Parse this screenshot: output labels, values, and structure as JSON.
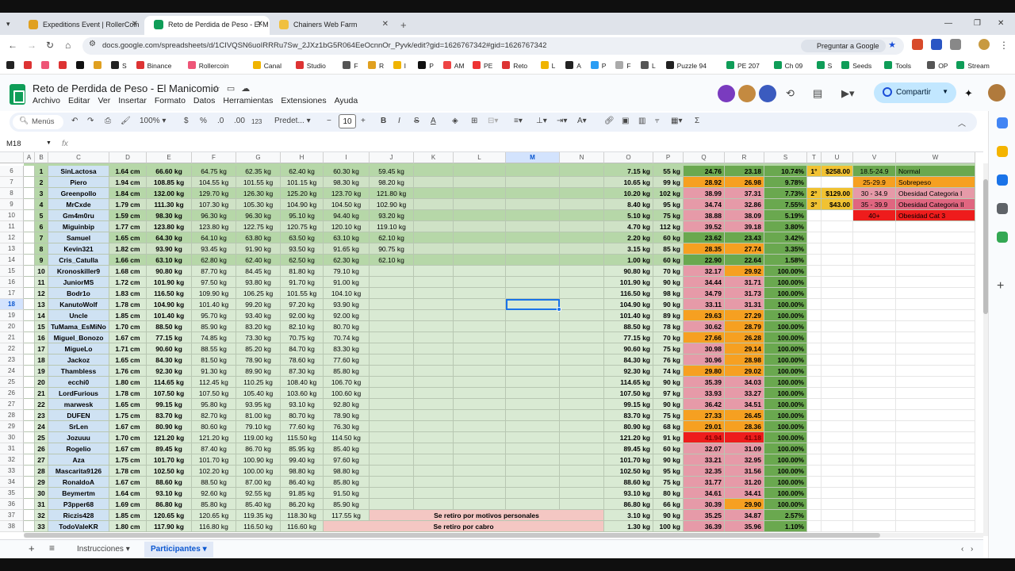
{
  "browser": {
    "tabs": [
      {
        "title": "Expeditions Event | RollerCoin",
        "active": false,
        "icon_color": "#e0a020"
      },
      {
        "title": "Reto de Perdida de Peso - El M",
        "active": true,
        "icon_color": "#0f9d58"
      },
      {
        "title": "Chainers Web Farm",
        "active": false,
        "icon_color": "#f0c040"
      }
    ],
    "url": "docs.google.com/spreadsheets/d/1CIVQSN6uoIRRRu7Sw_2JXz1bG5R064EeOcnnOr_Pyvk/edit?gid=1626767342#gid=1626767342",
    "google_btn": "Preguntar a Google",
    "bookmarks": [
      "S",
      "Binance",
      "Rollercoin",
      "Canal",
      "Studio",
      "F",
      "R",
      "I",
      "P",
      "AM",
      "PE",
      "Reto",
      "L",
      "A",
      "P",
      "F",
      "L",
      "Puzzle 94",
      "PE 207",
      "Ch 09",
      "S",
      "Seeds",
      "Tools",
      "OP",
      "Stream"
    ]
  },
  "sheets": {
    "title": "Reto de Perdida de Peso - El Manicomio",
    "menus": [
      "Archivo",
      "Editar",
      "Ver",
      "Insertar",
      "Formato",
      "Datos",
      "Herramientas",
      "Extensiones",
      "Ayuda"
    ],
    "share_label": "Compartir",
    "search_label": "Menús",
    "zoom": "100%",
    "currency": "$",
    "percent": "%",
    "dec_dec": ".0",
    "dec_inc": ".00",
    "num_fmt": "123",
    "font": "Predet...",
    "font_size": "10",
    "name_box": "M18",
    "fx": "fx",
    "sheet_tabs": [
      "Instrucciones",
      "Participantes"
    ],
    "active_sheet": "Participantes"
  },
  "grid": {
    "columns": [
      "A",
      "B",
      "C",
      "D",
      "E",
      "F",
      "G",
      "H",
      "I",
      "J",
      "K",
      "L",
      "M",
      "N",
      "O",
      "P",
      "Q",
      "R",
      "S",
      "T",
      "U",
      "V",
      "W"
    ],
    "selected_col": "M",
    "selected_row": 18,
    "rows": [
      {
        "n": 6,
        "num": "1",
        "name": "SinLactosa",
        "h": "1.64 cm",
        "w": [
          "66.60 kg",
          "64.75 kg",
          "62.35 kg",
          "62.40 kg",
          "60.30 kg",
          "59.45 kg"
        ],
        "lost": "7.15 kg",
        "goal": "55 kg",
        "q": "24.76",
        "r": "23.18",
        "s": "10.74%",
        "qc": "g",
        "rc": "g"
      },
      {
        "n": 7,
        "num": "2",
        "name": "Piero",
        "h": "1.94 cm",
        "w": [
          "108.85 kg",
          "104.55 kg",
          "101.55 kg",
          "101.15 kg",
          "98.30 kg",
          "98.20 kg"
        ],
        "lost": "10.65 kg",
        "goal": "99 kg",
        "q": "28.92",
        "r": "26.98",
        "s": "9.78%",
        "qc": "o",
        "rc": "o"
      },
      {
        "n": 8,
        "num": "3",
        "name": "Greenpollo",
        "h": "1.84 cm",
        "w": [
          "132.00 kg",
          "129.70 kg",
          "126.30 kg",
          "125.20 kg",
          "123.70 kg",
          "121.80 kg"
        ],
        "lost": "10.20 kg",
        "goal": "102 kg",
        "q": "38.99",
        "r": "37.31",
        "s": "7.73%",
        "qc": "p",
        "rc": "p"
      },
      {
        "n": 9,
        "num": "4",
        "name": "MrCxde",
        "h": "1.79 cm",
        "w": [
          "111.30 kg",
          "107.30 kg",
          "105.30 kg",
          "104.90 kg",
          "104.50 kg",
          "102.90 kg"
        ],
        "lost": "8.40 kg",
        "goal": "95 kg",
        "q": "34.74",
        "r": "32.86",
        "s": "7.55%",
        "qc": "p",
        "rc": "p"
      },
      {
        "n": 10,
        "num": "5",
        "name": "Gm4m0ru",
        "h": "1.59 cm",
        "w": [
          "98.30 kg",
          "96.30 kg",
          "96.30 kg",
          "95.10 kg",
          "94.40 kg",
          "93.20 kg"
        ],
        "lost": "5.10 kg",
        "goal": "75 kg",
        "q": "38.88",
        "r": "38.09",
        "s": "5.19%",
        "qc": "p",
        "rc": "p"
      },
      {
        "n": 11,
        "num": "6",
        "name": "Miguinbip",
        "h": "1.77 cm",
        "w": [
          "123.80 kg",
          "123.80 kg",
          "122.75 kg",
          "120.75 kg",
          "120.10 kg",
          "119.10 kg"
        ],
        "lost": "4.70 kg",
        "goal": "112 kg",
        "q": "39.52",
        "r": "39.18",
        "s": "3.80%",
        "qc": "p",
        "rc": "p"
      },
      {
        "n": 12,
        "num": "7",
        "name": "Samuel",
        "h": "1.65 cm",
        "w": [
          "64.30 kg",
          "64.10 kg",
          "63.80 kg",
          "63.50 kg",
          "63.10 kg",
          "62.10 kg"
        ],
        "lost": "2.20 kg",
        "goal": "60 kg",
        "q": "23.62",
        "r": "23.43",
        "s": "3.42%",
        "qc": "g",
        "rc": "g"
      },
      {
        "n": 13,
        "num": "8",
        "name": "Kevin321",
        "h": "1.82 cm",
        "w": [
          "93.90 kg",
          "93.45 kg",
          "91.90 kg",
          "93.50 kg",
          "91.65 kg",
          "90.75 kg"
        ],
        "lost": "3.15 kg",
        "goal": "85 kg",
        "q": "28.35",
        "r": "27.74",
        "s": "3.35%",
        "qc": "o",
        "rc": "o"
      },
      {
        "n": 14,
        "num": "9",
        "name": "Cris_Catulla",
        "h": "1.66 cm",
        "w": [
          "63.10 kg",
          "62.80 kg",
          "62.40 kg",
          "62.50 kg",
          "62.30 kg",
          "62.10 kg"
        ],
        "lost": "1.00 kg",
        "goal": "60 kg",
        "q": "22.90",
        "r": "22.64",
        "s": "1.58%",
        "qc": "g",
        "rc": "g"
      },
      {
        "n": 15,
        "num": "10",
        "name": "Kronoskiller9",
        "h": "1.68 cm",
        "w": [
          "90.80 kg",
          "87.70 kg",
          "84.45 kg",
          "81.80 kg",
          "79.10 kg",
          ""
        ],
        "lost": "90.80 kg",
        "goal": "70 kg",
        "q": "32.17",
        "r": "29.92",
        "s": "100.00%",
        "qc": "p",
        "rc": "o"
      },
      {
        "n": 16,
        "num": "11",
        "name": "JuniorMS",
        "h": "1.72 cm",
        "w": [
          "101.90 kg",
          "97.50 kg",
          "93.80 kg",
          "91.70 kg",
          "91.00 kg",
          ""
        ],
        "lost": "101.90 kg",
        "goal": "90 kg",
        "q": "34.44",
        "r": "31.71",
        "s": "100.00%",
        "qc": "p",
        "rc": "p"
      },
      {
        "n": 17,
        "num": "12",
        "name": "Bodr1o",
        "h": "1.83 cm",
        "w": [
          "116.50 kg",
          "109.90 kg",
          "106.25 kg",
          "101.55 kg",
          "104.10 kg",
          ""
        ],
        "lost": "116.50 kg",
        "goal": "98 kg",
        "q": "34.79",
        "r": "31.73",
        "s": "100.00%",
        "qc": "p",
        "rc": "p"
      },
      {
        "n": 18,
        "num": "13",
        "name": "KanutoWolf",
        "h": "1.78 cm",
        "w": [
          "104.90 kg",
          "101.40 kg",
          "99.20 kg",
          "97.20 kg",
          "93.90 kg",
          ""
        ],
        "lost": "104.90 kg",
        "goal": "90 kg",
        "q": "33.11",
        "r": "31.31",
        "s": "100.00%",
        "qc": "p",
        "rc": "p"
      },
      {
        "n": 19,
        "num": "14",
        "name": "Uncle",
        "h": "1.85 cm",
        "w": [
          "101.40 kg",
          "95.70 kg",
          "93.40 kg",
          "92.00 kg",
          "92.00 kg",
          ""
        ],
        "lost": "101.40 kg",
        "goal": "89 kg",
        "q": "29.63",
        "r": "27.29",
        "s": "100.00%",
        "qc": "o",
        "rc": "o"
      },
      {
        "n": 20,
        "num": "15",
        "name": "TuMama_EsMiNo",
        "h": "1.70 cm",
        "w": [
          "88.50 kg",
          "85.90 kg",
          "83.20 kg",
          "82.10 kg",
          "80.70 kg",
          ""
        ],
        "lost": "88.50 kg",
        "goal": "78 kg",
        "q": "30.62",
        "r": "28.79",
        "s": "100.00%",
        "qc": "p",
        "rc": "o"
      },
      {
        "n": 21,
        "num": "16",
        "name": "Miguel_Bonozo",
        "h": "1.67 cm",
        "w": [
          "77.15 kg",
          "74.85 kg",
          "73.30 kg",
          "70.75 kg",
          "70.74 kg",
          ""
        ],
        "lost": "77.15 kg",
        "goal": "70 kg",
        "q": "27.66",
        "r": "26.28",
        "s": "100.00%",
        "qc": "o",
        "rc": "o"
      },
      {
        "n": 22,
        "num": "17",
        "name": "MigueLo",
        "h": "1.71 cm",
        "w": [
          "90.60 kg",
          "88.55 kg",
          "85.20 kg",
          "84.70 kg",
          "83.30 kg",
          ""
        ],
        "lost": "90.60 kg",
        "goal": "75 kg",
        "q": "30.98",
        "r": "29.14",
        "s": "100.00%",
        "qc": "p",
        "rc": "o"
      },
      {
        "n": 23,
        "num": "18",
        "name": "Jackoz",
        "h": "1.65 cm",
        "w": [
          "84.30 kg",
          "81.50 kg",
          "78.90 kg",
          "78.60 kg",
          "77.60 kg",
          ""
        ],
        "lost": "84.30 kg",
        "goal": "76 kg",
        "q": "30.96",
        "r": "28.98",
        "s": "100.00%",
        "qc": "p",
        "rc": "o"
      },
      {
        "n": 24,
        "num": "19",
        "name": "Thambless",
        "h": "1.76 cm",
        "w": [
          "92.30 kg",
          "91.30 kg",
          "89.90 kg",
          "87.30 kg",
          "85.80 kg",
          ""
        ],
        "lost": "92.30 kg",
        "goal": "74 kg",
        "q": "29.80",
        "r": "29.02",
        "s": "100.00%",
        "qc": "o",
        "rc": "o"
      },
      {
        "n": 25,
        "num": "20",
        "name": "ecchi0",
        "h": "1.80 cm",
        "w": [
          "114.65 kg",
          "112.45 kg",
          "110.25 kg",
          "108.40 kg",
          "106.70 kg",
          ""
        ],
        "lost": "114.65 kg",
        "goal": "90 kg",
        "q": "35.39",
        "r": "34.03",
        "s": "100.00%",
        "qc": "p",
        "rc": "p"
      },
      {
        "n": 26,
        "num": "21",
        "name": "LordFurious",
        "h": "1.78 cm",
        "w": [
          "107.50 kg",
          "107.50 kg",
          "105.40 kg",
          "103.60 kg",
          "100.60 kg",
          ""
        ],
        "lost": "107.50 kg",
        "goal": "97 kg",
        "q": "33.93",
        "r": "33.27",
        "s": "100.00%",
        "qc": "p",
        "rc": "p"
      },
      {
        "n": 27,
        "num": "22",
        "name": "marwesk",
        "h": "1.65 cm",
        "w": [
          "99.15 kg",
          "95.80 kg",
          "93.95 kg",
          "93.10 kg",
          "92.80 kg",
          ""
        ],
        "lost": "99.15 kg",
        "goal": "90 kg",
        "q": "36.42",
        "r": "34.51",
        "s": "100.00%",
        "qc": "p",
        "rc": "p"
      },
      {
        "n": 28,
        "num": "23",
        "name": "DUFEN",
        "h": "1.75 cm",
        "w": [
          "83.70 kg",
          "82.70 kg",
          "81.00 kg",
          "80.70 kg",
          "78.90 kg",
          ""
        ],
        "lost": "83.70 kg",
        "goal": "75 kg",
        "q": "27.33",
        "r": "26.45",
        "s": "100.00%",
        "qc": "o",
        "rc": "o"
      },
      {
        "n": 29,
        "num": "24",
        "name": "SrLen",
        "h": "1.67 cm",
        "w": [
          "80.90 kg",
          "80.60 kg",
          "79.10 kg",
          "77.60 kg",
          "76.30 kg",
          ""
        ],
        "lost": "80.90 kg",
        "goal": "68 kg",
        "q": "29.01",
        "r": "28.36",
        "s": "100.00%",
        "qc": "o",
        "rc": "o"
      },
      {
        "n": 30,
        "num": "25",
        "name": "Jozuuu",
        "h": "1.70 cm",
        "w": [
          "121.20 kg",
          "121.20 kg",
          "119.00 kg",
          "115.50 kg",
          "114.50 kg",
          ""
        ],
        "lost": "121.20 kg",
        "goal": "91 kg",
        "q": "41.94",
        "r": "41.18",
        "s": "100.00%",
        "qc": "red",
        "rc": "red"
      },
      {
        "n": 31,
        "num": "26",
        "name": "Rogelio",
        "h": "1.67 cm",
        "w": [
          "89.45 kg",
          "87.40 kg",
          "86.70 kg",
          "85.95 kg",
          "85.40 kg",
          ""
        ],
        "lost": "89.45 kg",
        "goal": "60 kg",
        "q": "32.07",
        "r": "31.09",
        "s": "100.00%",
        "qc": "p",
        "rc": "p"
      },
      {
        "n": 32,
        "num": "27",
        "name": "Aza",
        "h": "1.75 cm",
        "w": [
          "101.70 kg",
          "101.70 kg",
          "100.90 kg",
          "99.40 kg",
          "97.60 kg",
          ""
        ],
        "lost": "101.70 kg",
        "goal": "90 kg",
        "q": "33.21",
        "r": "32.95",
        "s": "100.00%",
        "qc": "p",
        "rc": "p"
      },
      {
        "n": 33,
        "num": "28",
        "name": "Mascarita9126",
        "h": "1.78 cm",
        "w": [
          "102.50 kg",
          "102.20 kg",
          "100.00 kg",
          "98.80 kg",
          "98.80 kg",
          ""
        ],
        "lost": "102.50 kg",
        "goal": "95 kg",
        "q": "32.35",
        "r": "31.56",
        "s": "100.00%",
        "qc": "p",
        "rc": "p"
      },
      {
        "n": 34,
        "num": "29",
        "name": "RonaldoA",
        "h": "1.67 cm",
        "w": [
          "88.60 kg",
          "88.50 kg",
          "87.00 kg",
          "86.40 kg",
          "85.80 kg",
          ""
        ],
        "lost": "88.60 kg",
        "goal": "75 kg",
        "q": "31.77",
        "r": "31.20",
        "s": "100.00%",
        "qc": "p",
        "rc": "p"
      },
      {
        "n": 35,
        "num": "30",
        "name": "Beymertm",
        "h": "1.64 cm",
        "w": [
          "93.10 kg",
          "92.60 kg",
          "92.55 kg",
          "91.85 kg",
          "91.50 kg",
          ""
        ],
        "lost": "93.10 kg",
        "goal": "80 kg",
        "q": "34.61",
        "r": "34.41",
        "s": "100.00%",
        "qc": "p",
        "rc": "p"
      },
      {
        "n": 36,
        "num": "31",
        "name": "P3pper68",
        "h": "1.69 cm",
        "w": [
          "86.80 kg",
          "85.80 kg",
          "85.40 kg",
          "86.20 kg",
          "85.90 kg",
          ""
        ],
        "lost": "86.80 kg",
        "goal": "66 kg",
        "q": "30.39",
        "r": "29.90",
        "s": "100.00%",
        "qc": "p",
        "rc": "o"
      },
      {
        "n": 37,
        "num": "32",
        "name": "Riczis428",
        "h": "1.85 cm",
        "w": [
          "120.65 kg",
          "120.65 kg",
          "119.35 kg",
          "118.30 kg",
          "117.55 kg",
          ""
        ],
        "lost": "3.10 kg",
        "goal": "90 kg",
        "q": "35.25",
        "r": "34.87",
        "s": "2.57%",
        "qc": "p",
        "rc": "p",
        "note": "Se retiro por motivos personales",
        "note_from": "J"
      },
      {
        "n": 38,
        "num": "33",
        "name": "TodoValeKR",
        "h": "1.80 cm",
        "w": [
          "117.90 kg",
          "116.80 kg",
          "116.50 kg",
          "116.60 kg",
          "",
          ""
        ],
        "lost": "1.30 kg",
        "goal": "100 kg",
        "q": "36.39",
        "r": "35.96",
        "s": "1.10%",
        "qc": "p",
        "rc": "p",
        "note": "Se retiro por cabro",
        "note_from": "I"
      }
    ],
    "prizes": [
      {
        "row": 6,
        "place": "1°",
        "amount": "$258.00"
      },
      {
        "row": 8,
        "place": "2°",
        "amount": "$129.00"
      },
      {
        "row": 9,
        "place": "3°",
        "amount": "$43.00"
      }
    ],
    "legend": [
      {
        "range": "18.5-24.9",
        "label": "Normal",
        "color": "#6aa84f"
      },
      {
        "range": "25-29.9",
        "label": "Sobrepeso",
        "color": "#f6a021"
      },
      {
        "range": "30 - 34.9",
        "label": "Obesidad Categoria I",
        "color": "#e69aa8"
      },
      {
        "range": "35 - 39.9",
        "label": "Obesidad Categoria II",
        "color": "#e06680"
      },
      {
        "range": "40+",
        "label": "Obesidad Cat 3",
        "color": "#ee1c1c"
      }
    ]
  },
  "colors": {
    "light_green": "#d9ead3",
    "mid_green": "#b6d7a8",
    "selected_blue": "#d3e3fd",
    "accent_blue": "#0b57d0"
  }
}
